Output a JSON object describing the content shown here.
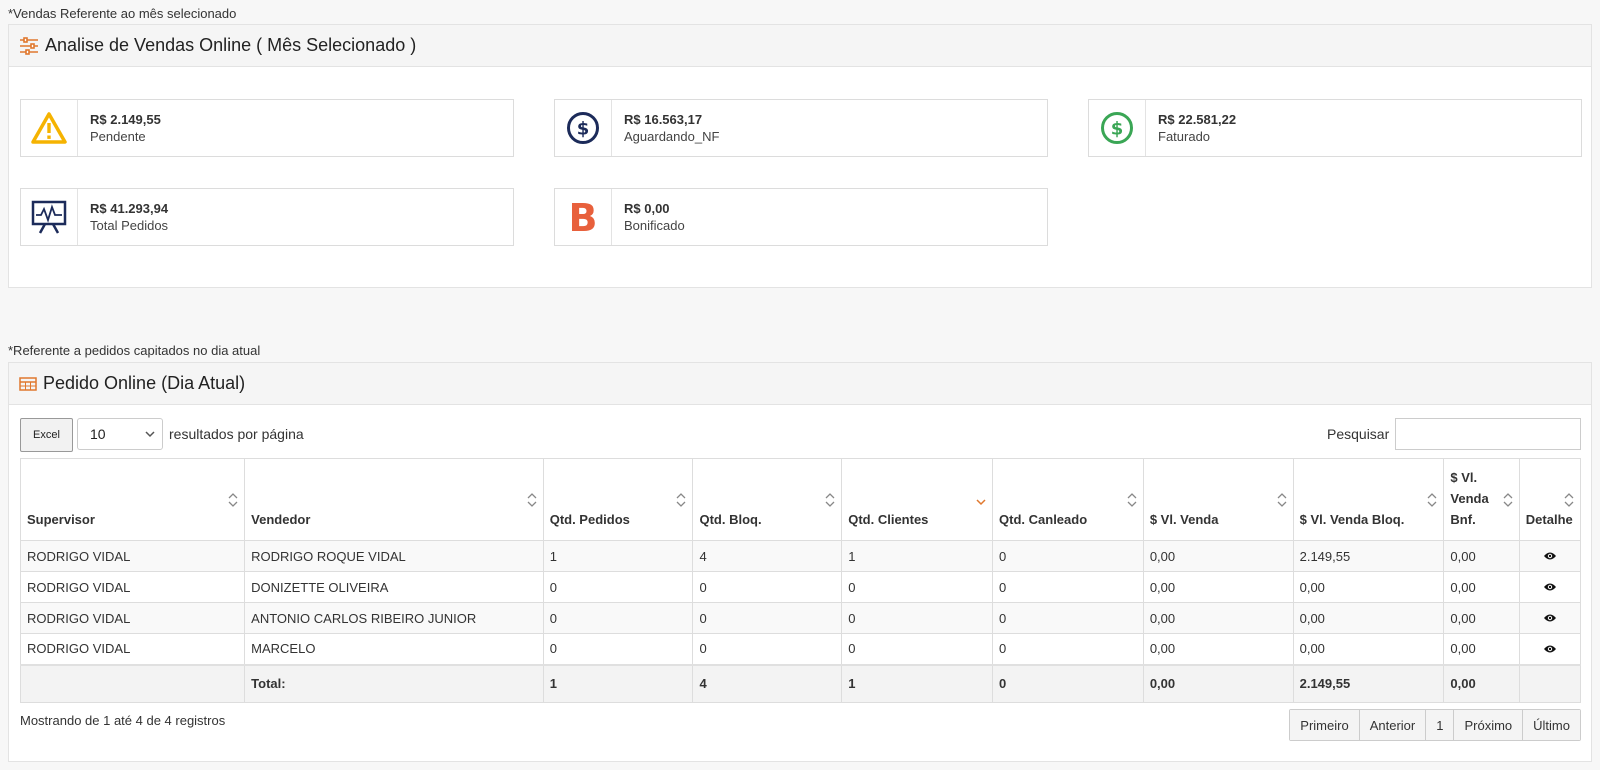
{
  "section1": {
    "note": "*Vendas Referente ao mês selecionado",
    "title": "Analise de Vendas Online ( Mês Selecionado )",
    "cards": [
      {
        "value": "R$ 2.149,55",
        "label": "Pendente",
        "icon": "warning-icon",
        "color": "#f5b301"
      },
      {
        "value": "R$ 16.563,17",
        "label": "Aguardando_NF",
        "icon": "dollar-circle-icon",
        "color": "#1c2b5a"
      },
      {
        "value": "R$ 22.581,22",
        "label": "Faturado",
        "icon": "dollar-circle-icon",
        "color": "#3aa655"
      },
      {
        "value": "R$ 41.293,94",
        "label": "Total Pedidos",
        "icon": "presentation-chart-icon",
        "color": "#1c2b5a"
      },
      {
        "value": "R$ 0,00",
        "label": "Bonificado",
        "icon": "bold-b-icon",
        "color": "#e8603c"
      }
    ]
  },
  "section2": {
    "note": "*Referente a pedidos capitados no dia atual",
    "title": "Pedido Online (Dia Atual)",
    "excel_label": "Excel",
    "page_size": "10",
    "per_page_label": "resultados por página",
    "search_label": "Pesquisar",
    "search_value": "",
    "columns": [
      "Supervisor",
      "Vendedor",
      "Qtd. Pedidos",
      "Qtd. Bloq.",
      "Qtd. Clientes",
      "Qtd. Canleado",
      "$ Vl. Venda",
      "$ Vl. Venda Bloq.",
      "$ Vl. Venda Bnf.",
      "Detalhe"
    ],
    "rows": [
      [
        "RODRIGO VIDAL",
        "RODRIGO ROQUE VIDAL",
        "1",
        "4",
        "1",
        "0",
        "0,00",
        "2.149,55",
        "0,00"
      ],
      [
        "RODRIGO VIDAL",
        "DONIZETTE OLIVEIRA",
        "0",
        "0",
        "0",
        "0",
        "0,00",
        "0,00",
        "0,00"
      ],
      [
        "RODRIGO VIDAL",
        "ANTONIO CARLOS RIBEIRO JUNIOR",
        "0",
        "0",
        "0",
        "0",
        "0,00",
        "0,00",
        "0,00"
      ],
      [
        "RODRIGO VIDAL",
        "MARCELO",
        "0",
        "0",
        "0",
        "0",
        "0,00",
        "0,00",
        "0,00"
      ]
    ],
    "footer": [
      "",
      "Total:",
      "1",
      "4",
      "1",
      "0",
      "0,00",
      "2.149,55",
      "0,00",
      ""
    ],
    "info": "Mostrando de 1 até 4 de 4 registros",
    "pager": [
      "Primeiro",
      "Anterior",
      "1",
      "Próximo",
      "Último"
    ],
    "accent": "#e0782e"
  }
}
